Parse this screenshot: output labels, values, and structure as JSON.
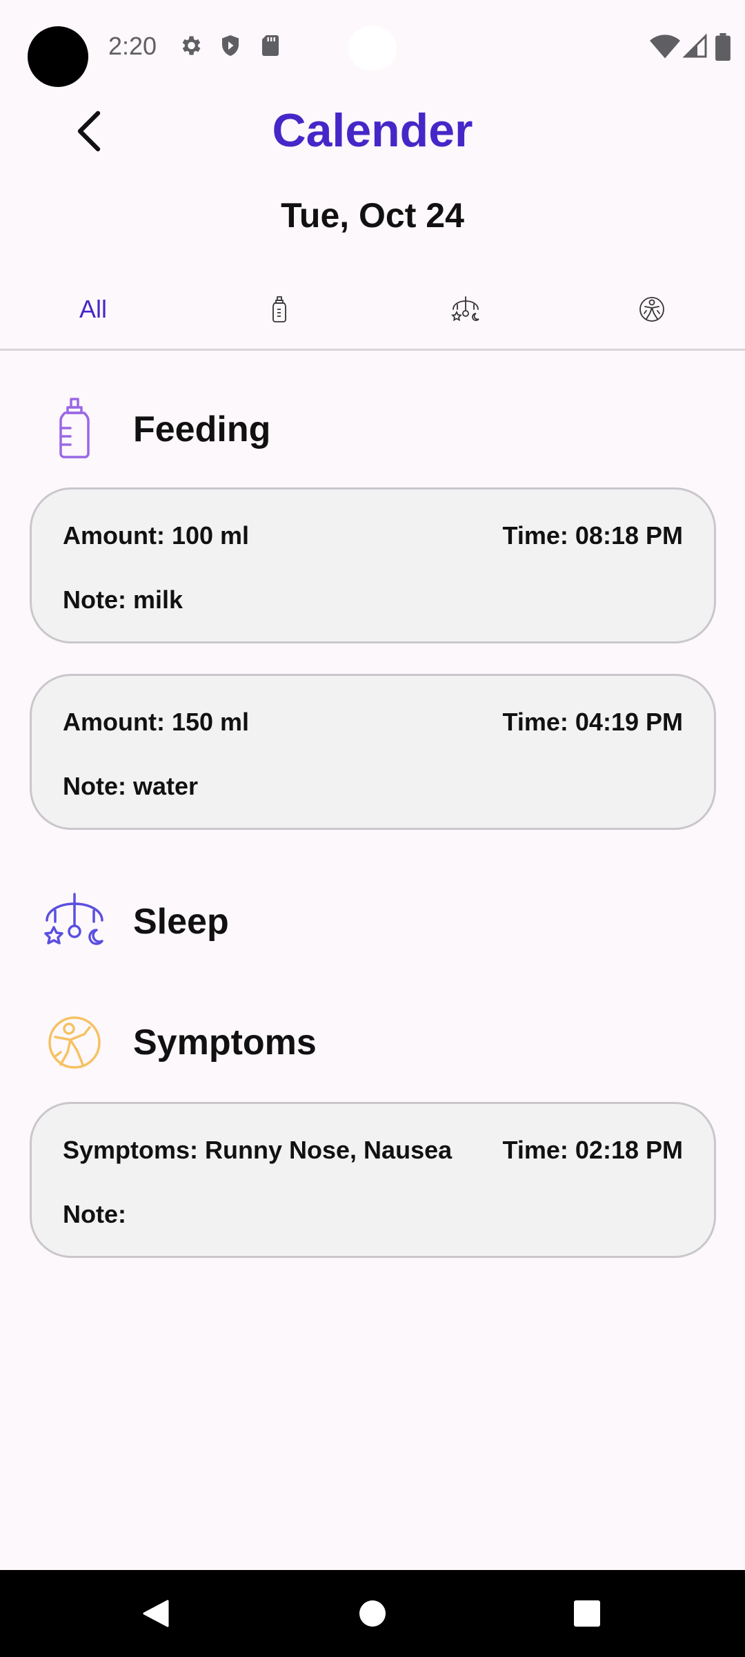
{
  "status_bar": {
    "time": "2:20",
    "left_icons": [
      "gear-icon",
      "shield-icon",
      "sd-card-icon"
    ],
    "right_icons": [
      "wifi-icon",
      "signal-icon",
      "battery-icon"
    ]
  },
  "header": {
    "title": "Calender",
    "date": "Tue, Oct 24"
  },
  "tabs": [
    {
      "label": "All",
      "icon": "",
      "selected": true
    },
    {
      "label": "",
      "icon": "baby-bottle-icon",
      "selected": false
    },
    {
      "label": "",
      "icon": "crib-mobile-icon",
      "selected": false
    },
    {
      "label": "",
      "icon": "symptoms-icon",
      "selected": false
    }
  ],
  "sections": {
    "feeding": {
      "title": "Feeding",
      "icon": "baby-bottle-icon",
      "entries": [
        {
          "amount": "Amount: 100 ml",
          "time": "Time: 08:18 PM",
          "note": "Note: milk"
        },
        {
          "amount": "Amount: 150 ml",
          "time": "Time: 04:19 PM",
          "note": "Note: water"
        }
      ]
    },
    "sleep": {
      "title": "Sleep",
      "icon": "crib-mobile-icon",
      "entries": []
    },
    "symptoms": {
      "title": "Symptoms",
      "icon": "symptoms-icon",
      "entries": [
        {
          "symptoms": "Symptoms: Runny Nose, Nausea",
          "time": "Time: 02:18 PM",
          "note": "Note:"
        }
      ]
    }
  },
  "colors": {
    "accent": "#4527c8",
    "feeding_icon": "#9a67e6",
    "sleep_icon": "#5a4fe0",
    "symptoms_icon": "#f5c263",
    "card_bg": "#f2f2f2",
    "page_bg": "#fdf8fb"
  },
  "nav_bar": [
    "back-triangle-icon",
    "home-circle-icon",
    "recents-square-icon"
  ]
}
